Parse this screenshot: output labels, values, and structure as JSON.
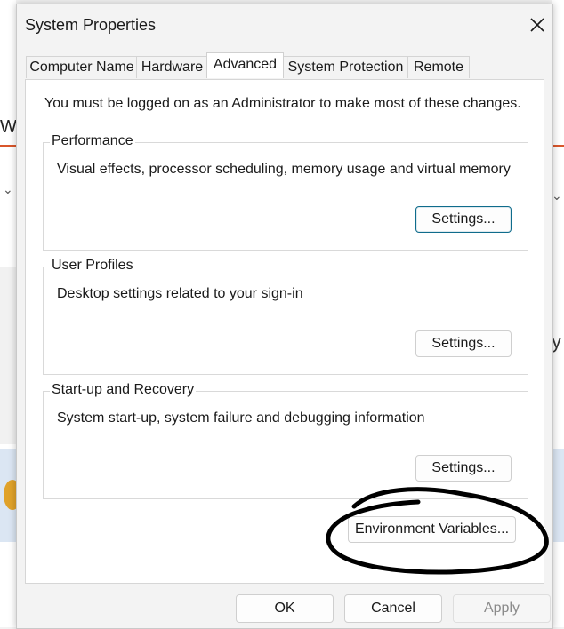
{
  "dialog": {
    "title": "System Properties"
  },
  "tabs": [
    {
      "label": "Computer Name",
      "active": false
    },
    {
      "label": "Hardware",
      "active": false
    },
    {
      "label": "Advanced",
      "active": true
    },
    {
      "label": "System Protection",
      "active": false
    },
    {
      "label": "Remote",
      "active": false
    }
  ],
  "advanced": {
    "admin_note": "You must be logged on as an Administrator to make most of these changes.",
    "groups": [
      {
        "title": "Performance",
        "description": "Visual effects, processor scheduling, memory usage and virtual memory",
        "button": "Settings..."
      },
      {
        "title": "User Profiles",
        "description": "Desktop settings related to your sign-in",
        "button": "Settings..."
      },
      {
        "title": "Start-up and Recovery",
        "description": "System start-up, system failure and debugging information",
        "button": "Settings..."
      }
    ],
    "env_button": "Environment Variables..."
  },
  "footer": {
    "ok": "OK",
    "cancel": "Cancel",
    "apply": "Apply"
  },
  "background": {
    "left_text": "W",
    "right_text": "y"
  },
  "colors": {
    "focus_border": "#0f6c8c",
    "annotation": "#000000"
  }
}
